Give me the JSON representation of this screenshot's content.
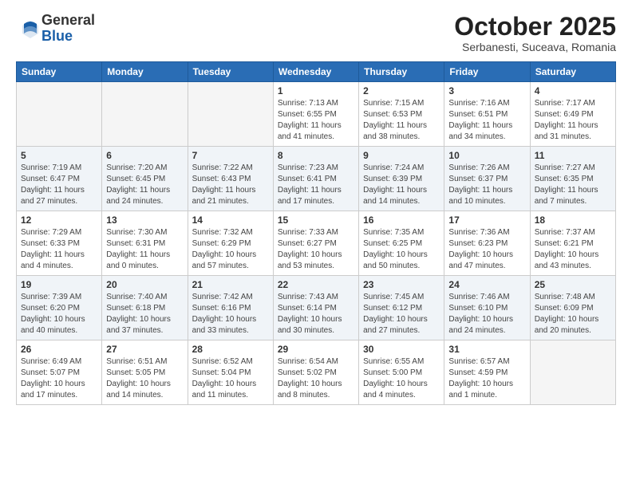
{
  "logo": {
    "general": "General",
    "blue": "Blue"
  },
  "title": "October 2025",
  "subtitle": "Serbanesti, Suceava, Romania",
  "days_of_week": [
    "Sunday",
    "Monday",
    "Tuesday",
    "Wednesday",
    "Thursday",
    "Friday",
    "Saturday"
  ],
  "weeks": [
    {
      "days": [
        {
          "num": "",
          "empty": true
        },
        {
          "num": "",
          "empty": true
        },
        {
          "num": "",
          "empty": true
        },
        {
          "num": "1",
          "sunrise": "7:13 AM",
          "sunset": "6:55 PM",
          "daylight": "11 hours and 41 minutes."
        },
        {
          "num": "2",
          "sunrise": "7:15 AM",
          "sunset": "6:53 PM",
          "daylight": "11 hours and 38 minutes."
        },
        {
          "num": "3",
          "sunrise": "7:16 AM",
          "sunset": "6:51 PM",
          "daylight": "11 hours and 34 minutes."
        },
        {
          "num": "4",
          "sunrise": "7:17 AM",
          "sunset": "6:49 PM",
          "daylight": "11 hours and 31 minutes."
        }
      ]
    },
    {
      "days": [
        {
          "num": "5",
          "sunrise": "7:19 AM",
          "sunset": "6:47 PM",
          "daylight": "11 hours and 27 minutes."
        },
        {
          "num": "6",
          "sunrise": "7:20 AM",
          "sunset": "6:45 PM",
          "daylight": "11 hours and 24 minutes."
        },
        {
          "num": "7",
          "sunrise": "7:22 AM",
          "sunset": "6:43 PM",
          "daylight": "11 hours and 21 minutes."
        },
        {
          "num": "8",
          "sunrise": "7:23 AM",
          "sunset": "6:41 PM",
          "daylight": "11 hours and 17 minutes."
        },
        {
          "num": "9",
          "sunrise": "7:24 AM",
          "sunset": "6:39 PM",
          "daylight": "11 hours and 14 minutes."
        },
        {
          "num": "10",
          "sunrise": "7:26 AM",
          "sunset": "6:37 PM",
          "daylight": "11 hours and 10 minutes."
        },
        {
          "num": "11",
          "sunrise": "7:27 AM",
          "sunset": "6:35 PM",
          "daylight": "11 hours and 7 minutes."
        }
      ]
    },
    {
      "days": [
        {
          "num": "12",
          "sunrise": "7:29 AM",
          "sunset": "6:33 PM",
          "daylight": "11 hours and 4 minutes."
        },
        {
          "num": "13",
          "sunrise": "7:30 AM",
          "sunset": "6:31 PM",
          "daylight": "11 hours and 0 minutes."
        },
        {
          "num": "14",
          "sunrise": "7:32 AM",
          "sunset": "6:29 PM",
          "daylight": "10 hours and 57 minutes."
        },
        {
          "num": "15",
          "sunrise": "7:33 AM",
          "sunset": "6:27 PM",
          "daylight": "10 hours and 53 minutes."
        },
        {
          "num": "16",
          "sunrise": "7:35 AM",
          "sunset": "6:25 PM",
          "daylight": "10 hours and 50 minutes."
        },
        {
          "num": "17",
          "sunrise": "7:36 AM",
          "sunset": "6:23 PM",
          "daylight": "10 hours and 47 minutes."
        },
        {
          "num": "18",
          "sunrise": "7:37 AM",
          "sunset": "6:21 PM",
          "daylight": "10 hours and 43 minutes."
        }
      ]
    },
    {
      "days": [
        {
          "num": "19",
          "sunrise": "7:39 AM",
          "sunset": "6:20 PM",
          "daylight": "10 hours and 40 minutes."
        },
        {
          "num": "20",
          "sunrise": "7:40 AM",
          "sunset": "6:18 PM",
          "daylight": "10 hours and 37 minutes."
        },
        {
          "num": "21",
          "sunrise": "7:42 AM",
          "sunset": "6:16 PM",
          "daylight": "10 hours and 33 minutes."
        },
        {
          "num": "22",
          "sunrise": "7:43 AM",
          "sunset": "6:14 PM",
          "daylight": "10 hours and 30 minutes."
        },
        {
          "num": "23",
          "sunrise": "7:45 AM",
          "sunset": "6:12 PM",
          "daylight": "10 hours and 27 minutes."
        },
        {
          "num": "24",
          "sunrise": "7:46 AM",
          "sunset": "6:10 PM",
          "daylight": "10 hours and 24 minutes."
        },
        {
          "num": "25",
          "sunrise": "7:48 AM",
          "sunset": "6:09 PM",
          "daylight": "10 hours and 20 minutes."
        }
      ]
    },
    {
      "days": [
        {
          "num": "26",
          "sunrise": "6:49 AM",
          "sunset": "5:07 PM",
          "daylight": "10 hours and 17 minutes."
        },
        {
          "num": "27",
          "sunrise": "6:51 AM",
          "sunset": "5:05 PM",
          "daylight": "10 hours and 14 minutes."
        },
        {
          "num": "28",
          "sunrise": "6:52 AM",
          "sunset": "5:04 PM",
          "daylight": "10 hours and 11 minutes."
        },
        {
          "num": "29",
          "sunrise": "6:54 AM",
          "sunset": "5:02 PM",
          "daylight": "10 hours and 8 minutes."
        },
        {
          "num": "30",
          "sunrise": "6:55 AM",
          "sunset": "5:00 PM",
          "daylight": "10 hours and 4 minutes."
        },
        {
          "num": "31",
          "sunrise": "6:57 AM",
          "sunset": "4:59 PM",
          "daylight": "10 hours and 1 minute."
        },
        {
          "num": "",
          "empty": true
        }
      ]
    }
  ],
  "labels": {
    "sunrise": "Sunrise:",
    "sunset": "Sunset:",
    "daylight": "Daylight:"
  }
}
